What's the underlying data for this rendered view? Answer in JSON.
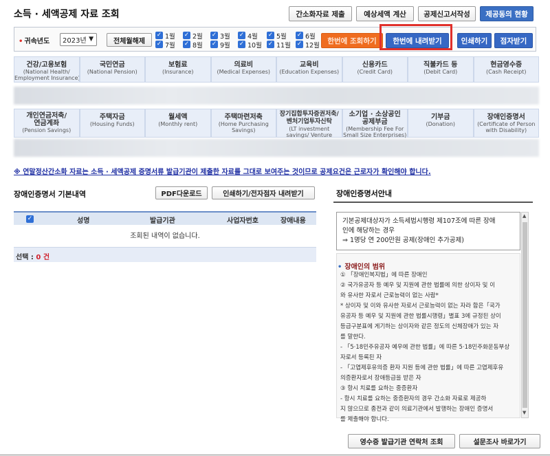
{
  "header": {
    "title": "소득 · 세액공제 자료 조회",
    "buttons": [
      "간소화자료 제출",
      "예상세액 계산",
      "공제신고서작성",
      "제공동의 현황"
    ]
  },
  "year_bar": {
    "label": "귀속년도",
    "year": "2023년",
    "clear_label": "전체월해제",
    "months_top": [
      "1월",
      "2월",
      "3월",
      "4월",
      "5월",
      "6월"
    ],
    "months_bottom": [
      "7월",
      "8월",
      "9월",
      "10월",
      "11월",
      "12월"
    ],
    "actions": [
      "한번에 조회하기",
      "한번에 내려받기",
      "인쇄하기",
      "점자받기"
    ]
  },
  "categories_row1": [
    {
      "kr": "건강/고용보험",
      "en": "(National Health/",
      "en2": "Employment Insurance)"
    },
    {
      "kr": "국민연금",
      "en": "(National Pension)",
      "en2": ""
    },
    {
      "kr": "보험료",
      "en": "(Insurance)",
      "en2": ""
    },
    {
      "kr": "의료비",
      "en": "(Medical Expenses)",
      "en2": ""
    },
    {
      "kr": "교육비",
      "en": "(Education Expenses)",
      "en2": ""
    },
    {
      "kr": "신용카드",
      "en": "(Credit Card)",
      "en2": ""
    },
    {
      "kr": "직불카드 등",
      "en": "(Debit Card)",
      "en2": ""
    },
    {
      "kr": "현금영수증",
      "en": "(Cash Receipt)",
      "en2": ""
    }
  ],
  "categories_row2": [
    {
      "kr": "개인연금저축/",
      "kr2": "연금계좌",
      "en": "(Pension Savings)"
    },
    {
      "kr": "주택자금",
      "kr2": "",
      "en": "(Housing Funds)"
    },
    {
      "kr": "월세액",
      "kr2": "",
      "en": "(Monthly rent)"
    },
    {
      "kr": "주택마련저축",
      "kr2": "",
      "en": "(Home Purchasing Savings)"
    },
    {
      "kr": "장기집합투자증권저축/",
      "kr2": "벤처기업투자신탁",
      "en": "(LT investment savings/ Venture investment"
    },
    {
      "kr": "소기업 · 소상공인",
      "kr2": "공제부금",
      "en": "(Membership Fee For Small Size Enterprises)"
    },
    {
      "kr": "기부금",
      "kr2": "",
      "en": "(Donation)"
    },
    {
      "kr": "장애인증명서",
      "kr2": "",
      "en": "(Certificate of Person with Disability)"
    }
  ],
  "notice": "※ 연말정산간소화 자료는 소득 · 세액공제 증명서류 발급기관이 제출한 자료를 그대로 보여주는 것이므로 공제요건은 근로자가 확인해야 합니다.",
  "left": {
    "title": "장애인증명서 기본내역",
    "pdf_btn": "PDF다운로드",
    "print_btn": "인쇄하기/전자점자 내려받기",
    "headers": [
      "성명",
      "발급기관",
      "사업자번호",
      "장애내용"
    ],
    "empty": "조회된 내역이 없습니다.",
    "select_label": "선택 : ",
    "select_count": "0 건"
  },
  "right": {
    "title": "장애인증명서안내",
    "info_lines": [
      "기본공제대상자가 소득세법시행령 제107조에 따른 장애",
      "인에 해당하는 경우",
      "⇒ 1명당 연 200만원 공제(장애인 추가공제)"
    ],
    "range_title": "장애인의 범위",
    "body": [
      "① 「장애인복지법」에 따른 장애인",
      "② 국가유공자 등 예우 및 지원에 관한 법률에 의한 상이자 및 이",
      "와 유사한 자로서 근로능력이 없는 사람*",
      "* 상이자 및 이와 유사한 자로서 근로능력이 없는 자라 함은「국가",
      "유공자 등 예우 및 지원에 관한 법률시행령」별표 3에 규정된 상이",
      "등급구분표에 게기하는 상이자와 같은 정도의 신체장애가 있는 자",
      "를 말한다.",
      "- 「5·18민주유공자 예우에 관한 법률」에 따른 5·18민주화운동부상",
      "자로서 등록된 자",
      "- 「고엽제후유의증 환자 지원 등에 관한 법률」에 따른 고엽제후유",
      "의증환자로서 장애등급을 받은 자",
      "③ 항시 치료를 요하는 중증환자",
      "- 항시 치료를 요하는 중증환자의 경우 간소화 자료로 제공하",
      "지 않으므로 종전과 같이 의료기관에서 발행하는 장애인 증명서",
      "를 제출해야 합니다."
    ]
  },
  "bottom": {
    "contact_btn": "영수증 발급기관 연락처 조회",
    "survey_btn": "설문조사 바로가기"
  }
}
